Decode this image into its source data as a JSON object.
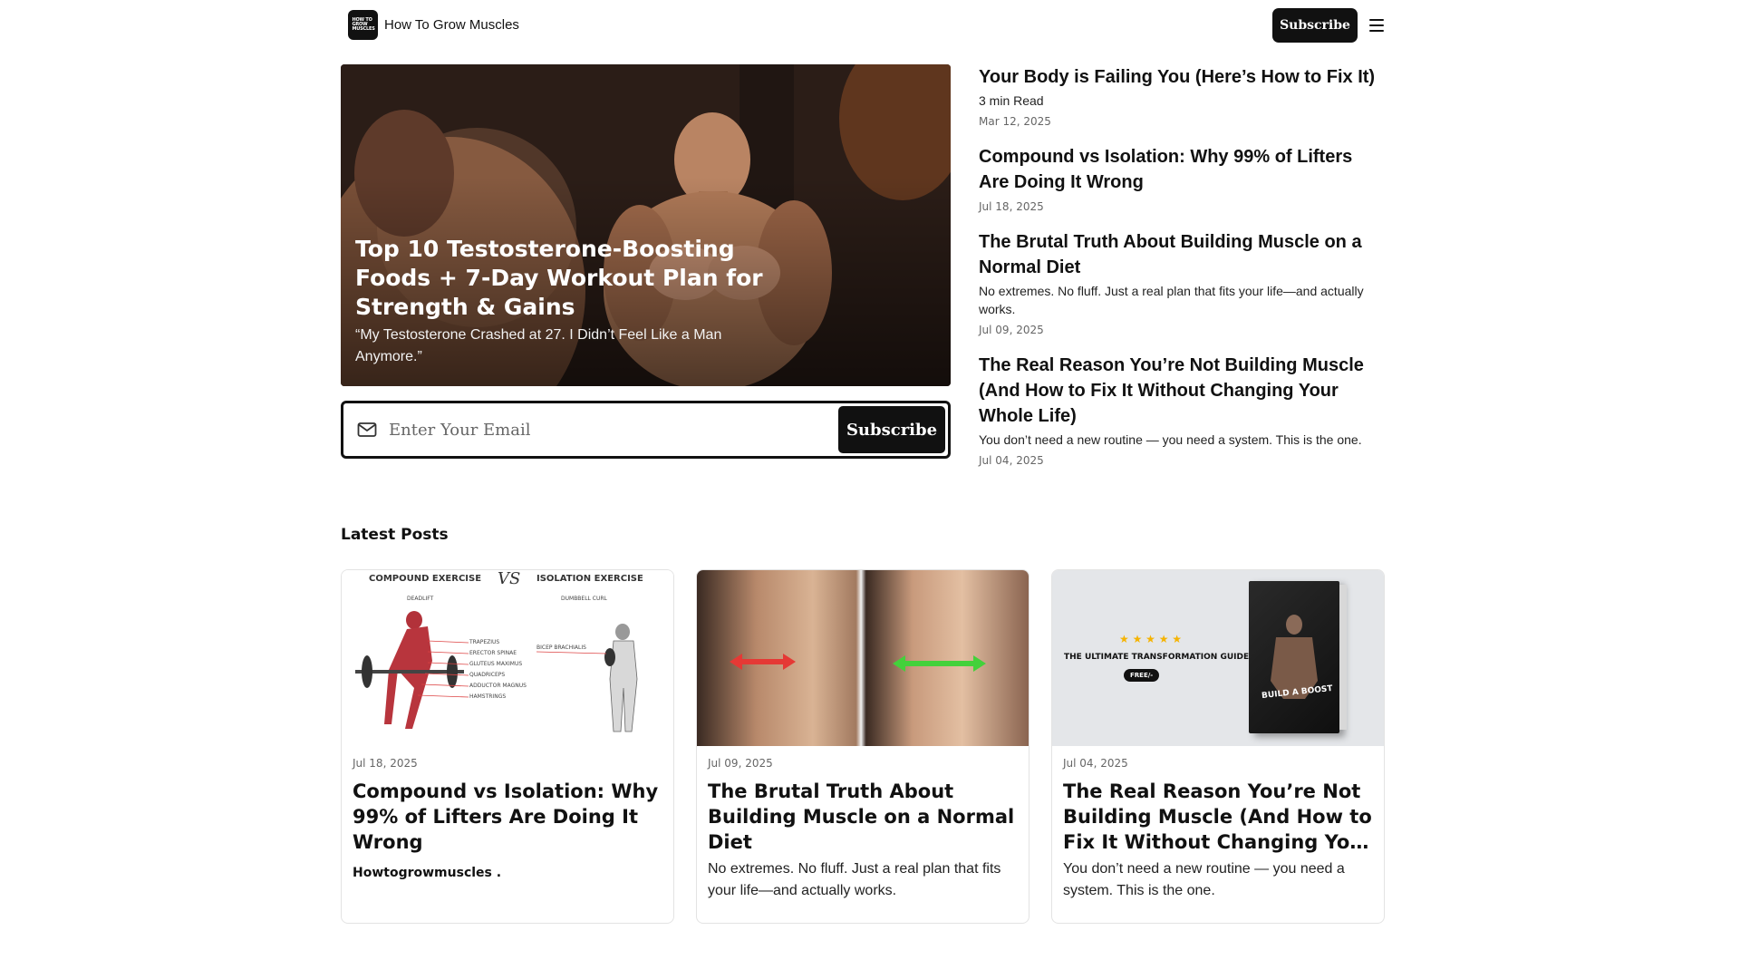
{
  "header": {
    "logo_text": "HOW TO GROW MUSCLES",
    "site_name": "How To Grow Muscles",
    "subscribe_label": "Subscribe"
  },
  "hero": {
    "title": "Top 10 Testosterone-Boosting Foods + 7-Day Workout Plan for Strength & Gains",
    "subtitle": "“My Testosterone Crashed at 27. I Didn’t Feel Like a Man Anymore.”"
  },
  "email_form": {
    "placeholder": "Enter Your Email",
    "button_label": "Subscribe"
  },
  "featured": [
    {
      "title": "Your Body is Failing You (Here’s How to Fix It)",
      "desc": "3 min Read",
      "date": "Mar 12, 2025"
    },
    {
      "title": "Compound vs Isolation: Why 99% of Lifters Are Doing It Wrong",
      "desc": "",
      "date": "Jul 18, 2025"
    },
    {
      "title": "The Brutal Truth About Building Muscle on a Normal Diet",
      "desc": "No extremes. No fluff. Just a real plan that fits your life—and actually works.",
      "date": "Jul 09, 2025"
    },
    {
      "title": "The Real Reason You’re Not Building Muscle (And How to Fix It Without Changing Your Whole Life)",
      "desc": "You don’t need a new routine — you need a system. This is the one.",
      "date": "Jul 04, 2025"
    }
  ],
  "latest": {
    "heading": "Latest Posts",
    "cards": [
      {
        "date": "Jul 18, 2025",
        "title": "Compound vs Isolation: Why 99% of Lifters Are Doing It Wrong",
        "author": "Howtogrowmuscles .",
        "image": {
          "left_heading": "COMPOUND EXERCISE",
          "vs": "VS",
          "right_heading": "ISOLATION EXERCISE",
          "left_exercise": "DEADLIFT",
          "right_exercise": "DUMBBELL CURL",
          "left_muscles": [
            "TRAPEZIUS",
            "ERECTOR SPINAE",
            "GLUTEUS MAXIMUS",
            "QUADRICEPS",
            "ADDUCTOR MAGNUS",
            "HAMSTRINGS"
          ],
          "right_muscle": "BICEP BRACHIALIS"
        }
      },
      {
        "date": "Jul 09, 2025",
        "title": "The Brutal Truth About Building Muscle on a Normal Diet",
        "desc": "No extremes. No fluff. Just a real plan that fits your life—and actually works."
      },
      {
        "date": "Jul 04, 2025",
        "title": "The Real Reason You’re Not Building Muscle (And How to Fix It Without Changing Your Whole Life)",
        "desc": "You don’t need a new routine — you need a system. This is the one.",
        "image": {
          "stars": "★ ★ ★ ★ ★",
          "guide_title": "THE ULTIMATE TRANSFORMATION GUIDE",
          "badge": "FREE/-",
          "book_title": "BUILD A BOOST"
        }
      }
    ]
  },
  "colors": {
    "primary_dark": "#111111",
    "muted_text": "#666666",
    "arrow_red": "#e53935",
    "arrow_green": "#43d13b",
    "star_gold": "#f5b301"
  }
}
